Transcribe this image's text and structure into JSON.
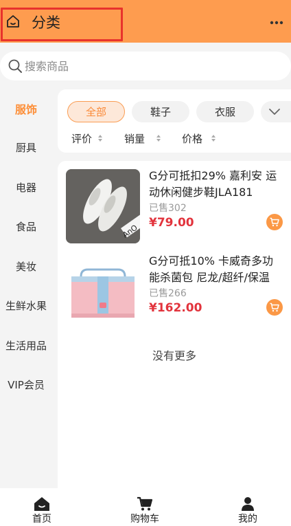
{
  "header": {
    "title": "分类",
    "home_icon": "home-icon",
    "more_icon": "more-icon"
  },
  "search": {
    "placeholder": "搜索商品",
    "value": "",
    "icon": "search-icon"
  },
  "sidebar": {
    "items": [
      {
        "label": "服饰",
        "active": true
      },
      {
        "label": "厨具"
      },
      {
        "label": "电器"
      },
      {
        "label": "食品"
      },
      {
        "label": "美妆"
      },
      {
        "label": "生鲜水果"
      },
      {
        "label": "生活用品"
      },
      {
        "label": "VIP会员"
      }
    ]
  },
  "filters": {
    "chips": [
      {
        "label": "全部",
        "active": true
      },
      {
        "label": "鞋子"
      },
      {
        "label": "衣服"
      }
    ],
    "sort": [
      {
        "label": "评价"
      },
      {
        "label": "销量"
      },
      {
        "label": "价格"
      }
    ]
  },
  "products": [
    {
      "title": "G分可抵扣29% 嘉利安 运动休闲健步鞋JLA181",
      "sold": "已售302",
      "price": "¥79.00",
      "image": "white-sneakers"
    },
    {
      "title": "G分可抵10% 卡威奇多功能杀菌包 尼龙/超纤/保温",
      "sold": "已售266",
      "price": "¥162.00",
      "image": "pink-sterilizer-bag"
    }
  ],
  "list_footer": "没有更多",
  "tabbar": {
    "items": [
      {
        "label": "首页",
        "icon": "home-filled-icon"
      },
      {
        "label": "购物车",
        "icon": "cart-icon"
      },
      {
        "label": "我的",
        "icon": "user-icon"
      }
    ]
  },
  "colors": {
    "header": "#fe9c4f",
    "accent": "#fd8e37",
    "price": "#e2333c",
    "highlight_box": "#e8322c"
  }
}
